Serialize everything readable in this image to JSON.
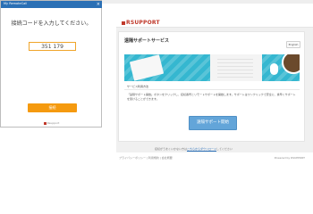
{
  "background_page": {
    "brand_name": "RSUPPORT",
    "card": {
      "title": "遠隔サポートサービス",
      "language_button": "English",
      "banner_caption": "サービス利用方法",
      "description": "「遠隔サポート開始」ボタンをクリックし、接続番号とリモートサポートを開始します。サポートはワンクリックで安全に、素早くサポートを受けることができます。",
      "start_button": "遠隔サポート開始"
    },
    "footer_line1_prefix": "接続がうまくいかない方は",
    "footer_line1_link": "こちらからダウンロード",
    "footer_line1_suffix": "してください",
    "footer_line2_left": "プライバシーポリシー | 利用規約 | 会社概要",
    "footer_line2_right": "Powered by RSUPPORT"
  },
  "popup": {
    "title": "My RemoteCall",
    "close_symbol": "×",
    "prompt": "接続コードを入力してください。",
    "code_value": "351 179",
    "connect_button": "接続",
    "logo_text": "Rsupport"
  },
  "colors": {
    "titlebar": "#2b70b5",
    "connect_button": "#f59a0f",
    "start_button": "#63a5d9",
    "brand": "#c0392b"
  }
}
